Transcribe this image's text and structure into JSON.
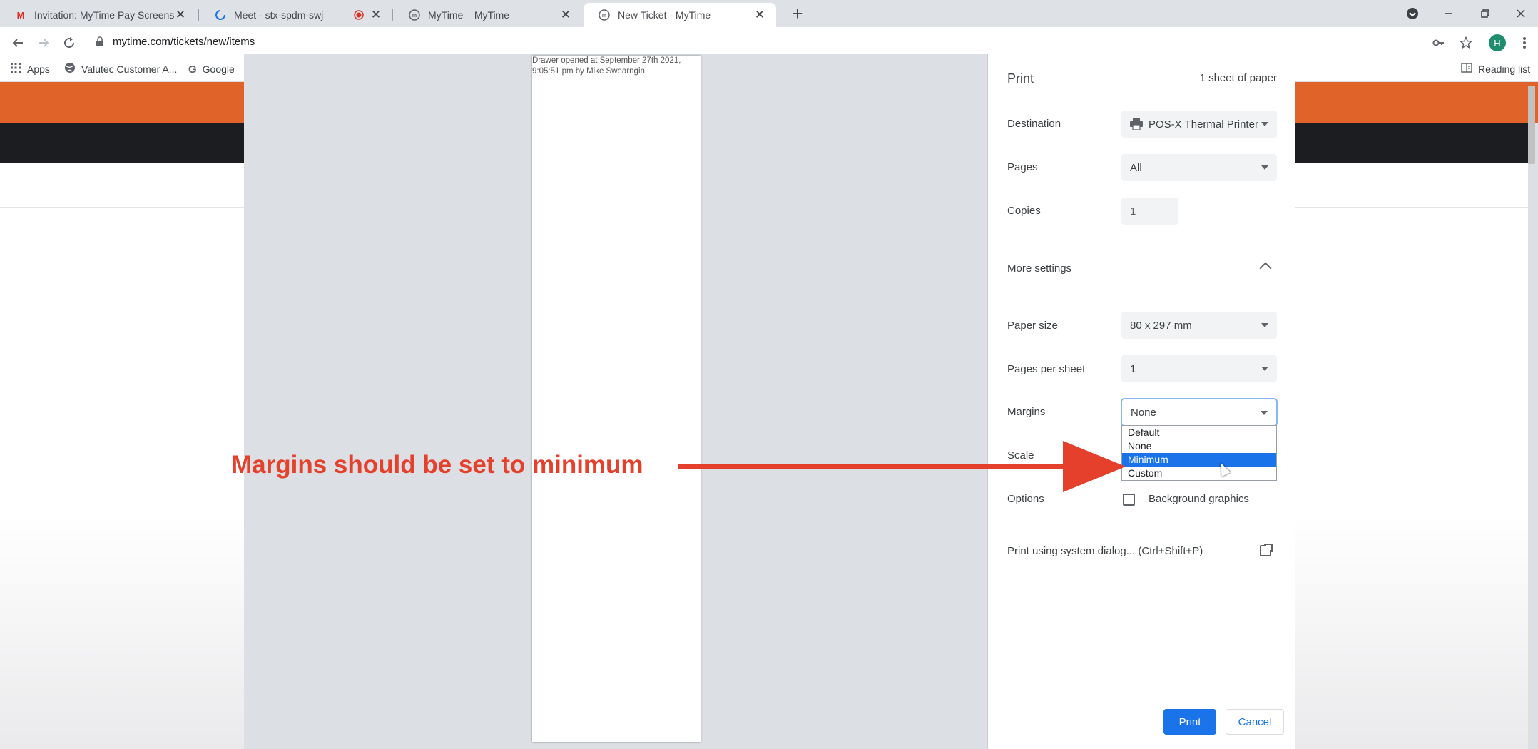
{
  "browser": {
    "tabs": [
      {
        "label": "Invitation: MyTime Pay Screensh...",
        "icon": "gmail-icon",
        "close": "✕"
      },
      {
        "label": "Meet - stx-spdm-swj",
        "icon": "loading-icon",
        "close": "✕"
      },
      {
        "label": "MyTime – MyTime",
        "icon": "mytime-icon",
        "close": "✕"
      },
      {
        "label": "New Ticket - MyTime",
        "icon": "mytime-icon",
        "close": "✕"
      }
    ],
    "new_tab": "+",
    "address": "mytime.com/tickets/new/items",
    "bookmarks": [
      {
        "label": "Apps",
        "icon": "apps-grid-icon"
      },
      {
        "label": "Valutec Customer A...",
        "icon": "globe-icon"
      },
      {
        "label": "Google",
        "icon": "google-icon"
      }
    ],
    "reading_list": "Reading list",
    "profile_initial": "H"
  },
  "preview": {
    "receipt_text": "Drawer opened at September 27th 2021, 9:05:51 pm by Mike Swearngin"
  },
  "print_panel": {
    "title": "Print",
    "sheets": "1 sheet of paper",
    "destination_label": "Destination",
    "destination_value": "POS-X Thermal Printer",
    "pages_label": "Pages",
    "pages_value": "All",
    "copies_label": "Copies",
    "copies_value": "1",
    "more_settings": "More settings",
    "paper_size_label": "Paper size",
    "paper_size_value": "80 x 297 mm",
    "pages_per_sheet_label": "Pages per sheet",
    "pages_per_sheet_value": "1",
    "margins_label": "Margins",
    "margins_value": "None",
    "margin_options": [
      "Default",
      "None",
      "Minimum",
      "Custom"
    ],
    "highlighted_option": "Minimum",
    "scale_label": "Scale",
    "options_label": "Options",
    "background_graphics": "Background graphics",
    "system_dialog": "Print using system dialog... (Ctrl+Shift+P)",
    "print_button": "Print",
    "cancel_button": "Cancel"
  },
  "annotation": {
    "text": "Margins should be set to minimum",
    "color": "#e5402b"
  },
  "colors": {
    "brand_orange": "#e0632a",
    "dark_nav": "#1b1d20",
    "accent_blue": "#1a73e8"
  }
}
